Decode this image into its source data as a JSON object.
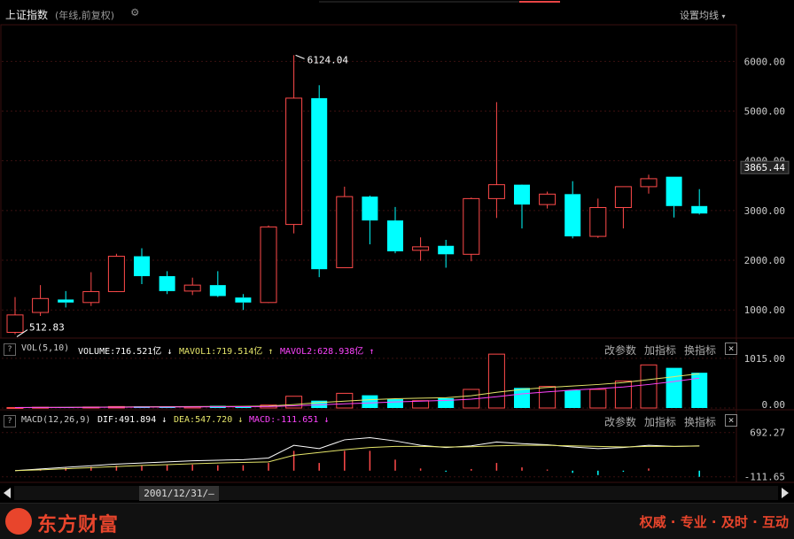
{
  "header": {
    "title": "上证指数",
    "subtitle": "(年线,前复权)",
    "set_ma_label": "设置均线"
  },
  "vol_header": {
    "help": "?",
    "name": "VOL(5,10)",
    "volume": "VOLUME:716.521亿",
    "mavol1": "MAVOL1:719.514亿",
    "mavol2": "MAVOL2:628.938亿"
  },
  "macd_header": {
    "help": "?",
    "name": "MACD(12,26,9)",
    "dif": "DIF:491.894",
    "dea": "DEA:547.720",
    "macd": "MACD:-111.651"
  },
  "panel_buttons": {
    "params": "改参数",
    "add": "加指标",
    "switch": "换指标",
    "close": "×"
  },
  "date_label": "2001/12/31/—",
  "footer": {
    "brand": "东方财富",
    "slogan": "权威 · 专业 · 及时 · 互动"
  },
  "colors": {
    "up": "#ff4a4a",
    "down": "#00ffff",
    "dif": "#ffffff",
    "dea": "#e5e56a",
    "ma_pink": "#ff44ff",
    "accent_white": "#ffffff",
    "axis_text": "#cccccc"
  },
  "chart_data": {
    "type": "candlestick",
    "y_ticks": [
      "1000.00",
      "2000.00",
      "3000.00",
      "4000.00",
      "5000.00",
      "6000.00"
    ],
    "ylim": [
      470,
      6700
    ],
    "last_price_label": "3865.44",
    "annotations": {
      "high": "6124.04",
      "low": "512.83"
    },
    "candles": [
      {
        "o": 550,
        "c": 900,
        "h": 1260,
        "l": 512.83
      },
      {
        "o": 950,
        "c": 1230,
        "h": 1500,
        "l": 880
      },
      {
        "o": 1210,
        "c": 1150,
        "h": 1380,
        "l": 1050
      },
      {
        "o": 1150,
        "c": 1370,
        "h": 1760,
        "l": 1080
      },
      {
        "o": 1370,
        "c": 2080,
        "h": 2130,
        "l": 1360
      },
      {
        "o": 2080,
        "c": 1680,
        "h": 2240,
        "l": 1520
      },
      {
        "o": 1680,
        "c": 1380,
        "h": 1780,
        "l": 1320
      },
      {
        "o": 1380,
        "c": 1500,
        "h": 1650,
        "l": 1300
      },
      {
        "o": 1500,
        "c": 1280,
        "h": 1780,
        "l": 1260
      },
      {
        "o": 1250,
        "c": 1150,
        "h": 1320,
        "l": 1000
      },
      {
        "o": 1150,
        "c": 2670,
        "h": 2700,
        "l": 1140
      },
      {
        "o": 2720,
        "c": 5260,
        "h": 6124.04,
        "l": 2540
      },
      {
        "o": 5260,
        "c": 1820,
        "h": 5520,
        "l": 1660
      },
      {
        "o": 1850,
        "c": 3280,
        "h": 3480,
        "l": 1850
      },
      {
        "o": 3280,
        "c": 2800,
        "h": 3300,
        "l": 2320
      },
      {
        "o": 2800,
        "c": 2180,
        "h": 3070,
        "l": 2140
      },
      {
        "o": 2200,
        "c": 2270,
        "h": 2460,
        "l": 1990
      },
      {
        "o": 2290,
        "c": 2120,
        "h": 2410,
        "l": 1850
      },
      {
        "o": 2120,
        "c": 3240,
        "h": 3260,
        "l": 1980
      },
      {
        "o": 3240,
        "c": 3520,
        "h": 5180,
        "l": 2850
      },
      {
        "o": 3520,
        "c": 3120,
        "h": 3510,
        "l": 2640
      },
      {
        "o": 3120,
        "c": 3330,
        "h": 3380,
        "l": 3040
      },
      {
        "o": 3330,
        "c": 2480,
        "h": 3590,
        "l": 2440
      },
      {
        "o": 2480,
        "c": 3060,
        "h": 3240,
        "l": 2450
      },
      {
        "o": 3060,
        "c": 3480,
        "h": 3470,
        "l": 2640
      },
      {
        "o": 3480,
        "c": 3640,
        "h": 3720,
        "l": 3340
      },
      {
        "o": 3680,
        "c": 3090,
        "h": 3680,
        "l": 2860
      },
      {
        "o": 3090,
        "c": 2940,
        "h": 3430,
        "l": 2920
      }
    ],
    "volume": {
      "y_ticks": [
        "1015.00",
        "0.00"
      ],
      "ylim": [
        0,
        1030
      ],
      "values": [
        10,
        15,
        18,
        20,
        30,
        35,
        20,
        25,
        45,
        35,
        60,
        240,
        150,
        300,
        260,
        180,
        150,
        200,
        380,
        1100,
        410,
        440,
        360,
        380,
        550,
        880,
        820,
        720
      ],
      "ma_line_a": [
        10,
        12,
        14,
        16,
        20,
        25,
        28,
        30,
        32,
        34,
        40,
        70,
        110,
        140,
        170,
        190,
        200,
        210,
        250,
        320,
        380,
        420,
        450,
        480,
        520,
        580,
        640,
        700
      ],
      "ma_line_b": [
        10,
        11,
        12,
        13,
        15,
        18,
        20,
        22,
        24,
        26,
        30,
        45,
        65,
        85,
        105,
        125,
        140,
        155,
        180,
        230,
        290,
        330,
        365,
        395,
        430,
        480,
        540,
        610
      ]
    },
    "macd": {
      "y_ticks": [
        "692.27",
        "-111.65"
      ],
      "ylim": [
        -180,
        800
      ],
      "dif": [
        0,
        30,
        60,
        90,
        120,
        140,
        160,
        180,
        190,
        200,
        230,
        460,
        400,
        560,
        600,
        540,
        460,
        420,
        450,
        520,
        490,
        470,
        430,
        400,
        420,
        460,
        440,
        450
      ],
      "dea": [
        0,
        15,
        35,
        55,
        75,
        95,
        110,
        125,
        140,
        150,
        160,
        280,
        330,
        380,
        420,
        440,
        440,
        430,
        435,
        450,
        460,
        460,
        450,
        440,
        430,
        440,
        440,
        447
      ],
      "hist": [
        0,
        30,
        50,
        70,
        90,
        90,
        100,
        110,
        100,
        100,
        140,
        360,
        140,
        360,
        360,
        200,
        40,
        -20,
        30,
        140,
        60,
        20,
        -40,
        -80,
        -20,
        40,
        0,
        -111.651
      ]
    }
  }
}
